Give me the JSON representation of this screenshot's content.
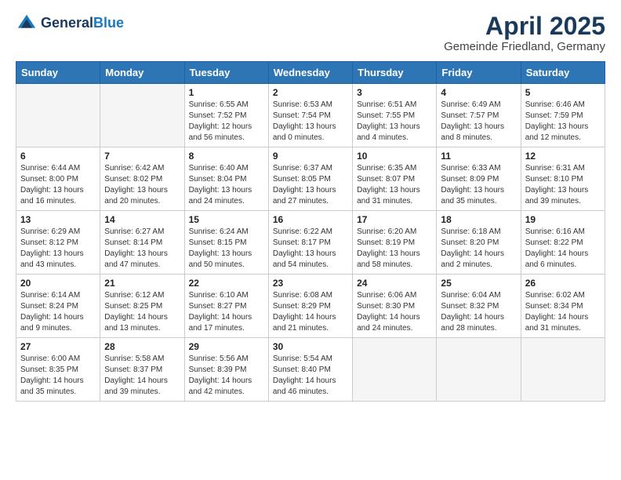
{
  "logo": {
    "general": "General",
    "blue": "Blue"
  },
  "title": "April 2025",
  "subtitle": "Gemeinde Friedland, Germany",
  "days_of_week": [
    "Sunday",
    "Monday",
    "Tuesday",
    "Wednesday",
    "Thursday",
    "Friday",
    "Saturday"
  ],
  "weeks": [
    [
      {
        "day": "",
        "empty": true
      },
      {
        "day": "",
        "empty": true
      },
      {
        "day": "1",
        "sunrise": "6:55 AM",
        "sunset": "7:52 PM",
        "daylight": "12 hours and 56 minutes."
      },
      {
        "day": "2",
        "sunrise": "6:53 AM",
        "sunset": "7:54 PM",
        "daylight": "13 hours and 0 minutes."
      },
      {
        "day": "3",
        "sunrise": "6:51 AM",
        "sunset": "7:55 PM",
        "daylight": "13 hours and 4 minutes."
      },
      {
        "day": "4",
        "sunrise": "6:49 AM",
        "sunset": "7:57 PM",
        "daylight": "13 hours and 8 minutes."
      },
      {
        "day": "5",
        "sunrise": "6:46 AM",
        "sunset": "7:59 PM",
        "daylight": "13 hours and 12 minutes."
      }
    ],
    [
      {
        "day": "6",
        "sunrise": "6:44 AM",
        "sunset": "8:00 PM",
        "daylight": "13 hours and 16 minutes."
      },
      {
        "day": "7",
        "sunrise": "6:42 AM",
        "sunset": "8:02 PM",
        "daylight": "13 hours and 20 minutes."
      },
      {
        "day": "8",
        "sunrise": "6:40 AM",
        "sunset": "8:04 PM",
        "daylight": "13 hours and 24 minutes."
      },
      {
        "day": "9",
        "sunrise": "6:37 AM",
        "sunset": "8:05 PM",
        "daylight": "13 hours and 27 minutes."
      },
      {
        "day": "10",
        "sunrise": "6:35 AM",
        "sunset": "8:07 PM",
        "daylight": "13 hours and 31 minutes."
      },
      {
        "day": "11",
        "sunrise": "6:33 AM",
        "sunset": "8:09 PM",
        "daylight": "13 hours and 35 minutes."
      },
      {
        "day": "12",
        "sunrise": "6:31 AM",
        "sunset": "8:10 PM",
        "daylight": "13 hours and 39 minutes."
      }
    ],
    [
      {
        "day": "13",
        "sunrise": "6:29 AM",
        "sunset": "8:12 PM",
        "daylight": "13 hours and 43 minutes."
      },
      {
        "day": "14",
        "sunrise": "6:27 AM",
        "sunset": "8:14 PM",
        "daylight": "13 hours and 47 minutes."
      },
      {
        "day": "15",
        "sunrise": "6:24 AM",
        "sunset": "8:15 PM",
        "daylight": "13 hours and 50 minutes."
      },
      {
        "day": "16",
        "sunrise": "6:22 AM",
        "sunset": "8:17 PM",
        "daylight": "13 hours and 54 minutes."
      },
      {
        "day": "17",
        "sunrise": "6:20 AM",
        "sunset": "8:19 PM",
        "daylight": "13 hours and 58 minutes."
      },
      {
        "day": "18",
        "sunrise": "6:18 AM",
        "sunset": "8:20 PM",
        "daylight": "14 hours and 2 minutes."
      },
      {
        "day": "19",
        "sunrise": "6:16 AM",
        "sunset": "8:22 PM",
        "daylight": "14 hours and 6 minutes."
      }
    ],
    [
      {
        "day": "20",
        "sunrise": "6:14 AM",
        "sunset": "8:24 PM",
        "daylight": "14 hours and 9 minutes."
      },
      {
        "day": "21",
        "sunrise": "6:12 AM",
        "sunset": "8:25 PM",
        "daylight": "14 hours and 13 minutes."
      },
      {
        "day": "22",
        "sunrise": "6:10 AM",
        "sunset": "8:27 PM",
        "daylight": "14 hours and 17 minutes."
      },
      {
        "day": "23",
        "sunrise": "6:08 AM",
        "sunset": "8:29 PM",
        "daylight": "14 hours and 21 minutes."
      },
      {
        "day": "24",
        "sunrise": "6:06 AM",
        "sunset": "8:30 PM",
        "daylight": "14 hours and 24 minutes."
      },
      {
        "day": "25",
        "sunrise": "6:04 AM",
        "sunset": "8:32 PM",
        "daylight": "14 hours and 28 minutes."
      },
      {
        "day": "26",
        "sunrise": "6:02 AM",
        "sunset": "8:34 PM",
        "daylight": "14 hours and 31 minutes."
      }
    ],
    [
      {
        "day": "27",
        "sunrise": "6:00 AM",
        "sunset": "8:35 PM",
        "daylight": "14 hours and 35 minutes."
      },
      {
        "day": "28",
        "sunrise": "5:58 AM",
        "sunset": "8:37 PM",
        "daylight": "14 hours and 39 minutes."
      },
      {
        "day": "29",
        "sunrise": "5:56 AM",
        "sunset": "8:39 PM",
        "daylight": "14 hours and 42 minutes."
      },
      {
        "day": "30",
        "sunrise": "5:54 AM",
        "sunset": "8:40 PM",
        "daylight": "14 hours and 46 minutes."
      },
      {
        "day": "",
        "empty": true
      },
      {
        "day": "",
        "empty": true
      },
      {
        "day": "",
        "empty": true
      }
    ]
  ]
}
